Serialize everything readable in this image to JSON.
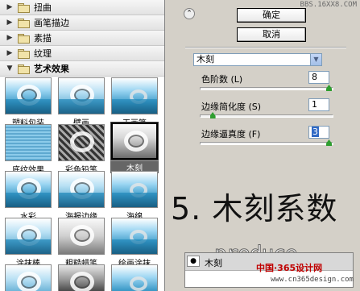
{
  "watermark_top": "BBS.16XX8.COM",
  "folders": [
    {
      "label": "扭曲",
      "open": false,
      "arrow": "▶"
    },
    {
      "label": "画笔描边",
      "open": false,
      "arrow": "▶"
    },
    {
      "label": "素描",
      "open": false,
      "arrow": "▶"
    },
    {
      "label": "纹理",
      "open": false,
      "arrow": "▶"
    },
    {
      "label": "艺术效果",
      "open": true,
      "arrow": "▼"
    }
  ],
  "filters": [
    {
      "label": "塑料包装"
    },
    {
      "label": "壁画"
    },
    {
      "label": "干画笔"
    },
    {
      "label": "底纹效果"
    },
    {
      "label": "彩色铅笔"
    },
    {
      "label": "木刻"
    },
    {
      "label": "水彩"
    },
    {
      "label": "海报边缘"
    },
    {
      "label": "海绵"
    },
    {
      "label": "涂抹棒"
    },
    {
      "label": "粗糙蜡笔"
    },
    {
      "label": "绘画涂抹"
    },
    {
      "label": ""
    },
    {
      "label": ""
    },
    {
      "label": ""
    }
  ],
  "buttons": {
    "ok": "确定",
    "cancel": "取消",
    "collapse": "⌃"
  },
  "filter_select": {
    "value": "木刻",
    "dropdown_icon": "▼"
  },
  "params": [
    {
      "label": "色阶数 (L)",
      "value": "8",
      "level": 0.97
    },
    {
      "label": "边缘简化度 (S)",
      "value": "1",
      "level": 0.1
    },
    {
      "label": "边缘逼真度 (F)",
      "value": "3",
      "level": 0.97
    }
  ],
  "caption": "5. 木刻系数",
  "layers": {
    "name": "木刻",
    "eye_icon": "●"
  },
  "watermark_produce": "produce",
  "watermark_bottom": "中国·365设计网",
  "watermark_url": "www.cn365design.com"
}
